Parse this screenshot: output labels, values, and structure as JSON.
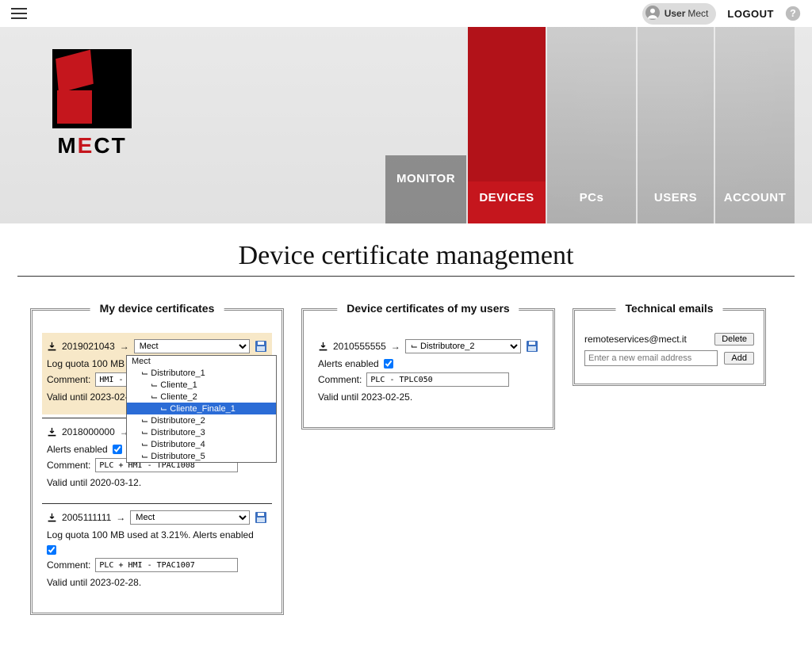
{
  "topbar": {
    "user_label": "User",
    "user_name": "Mect",
    "logout": "LOGOUT"
  },
  "logo": {
    "text_m": "M",
    "text_e": "E",
    "text_ct": "CT"
  },
  "nav": {
    "monitor": "MONITOR",
    "devices": "DEVICES",
    "pcs": "PCs",
    "users": "USERS",
    "account": "ACCOUNT"
  },
  "page_title": "Device certificate management",
  "panels": {
    "my_title": "My device certificates",
    "users_title": "Device certificates of my users",
    "emails_title": "Technical emails"
  },
  "my_certs": [
    {
      "id": "2019021043",
      "select_value": "Mect",
      "quota_line": "Log quota 100 MB u",
      "comment_label": "Comment:",
      "comment_value": "HMI - TP",
      "valid": "Valid until 2023-02-2"
    },
    {
      "id": "2018000000",
      "select_value": "",
      "alerts_label": "Alerts enabled",
      "comment_label": "Comment:",
      "comment_value": "PLC + HMI - TPAC1008",
      "valid": "Valid until 2020-03-12."
    },
    {
      "id": "2005111111",
      "select_value": "Mect",
      "quota_line": "Log quota 100 MB used at  3.21%.  Alerts enabled",
      "comment_label": "Comment:",
      "comment_value": "PLC + HMI - TPAC1007",
      "valid": "Valid until 2023-02-28."
    }
  ],
  "dropdown": {
    "options": [
      {
        "label": "Mect",
        "indent": 0,
        "sel": false
      },
      {
        "label": "Distributore_1",
        "indent": 1,
        "sel": false
      },
      {
        "label": "Cliente_1",
        "indent": 2,
        "sel": false
      },
      {
        "label": "Cliente_2",
        "indent": 2,
        "sel": false
      },
      {
        "label": "Cliente_Finale_1",
        "indent": 3,
        "sel": true
      },
      {
        "label": "Distributore_2",
        "indent": 1,
        "sel": false
      },
      {
        "label": "Distributore_3",
        "indent": 1,
        "sel": false
      },
      {
        "label": "Distributore_4",
        "indent": 1,
        "sel": false
      },
      {
        "label": "Distributore_5",
        "indent": 1,
        "sel": false
      }
    ]
  },
  "user_certs": [
    {
      "id": "2010555555",
      "select_value": "⌙ Distributore_2",
      "alerts_label": "Alerts enabled",
      "comment_label": "Comment:",
      "comment_value": "PLC - TPLC050",
      "valid": "Valid until 2023-02-25."
    }
  ],
  "emails": {
    "existing": "remoteservices@mect.it",
    "delete": "Delete",
    "placeholder": "Enter a new email address",
    "add": "Add"
  }
}
